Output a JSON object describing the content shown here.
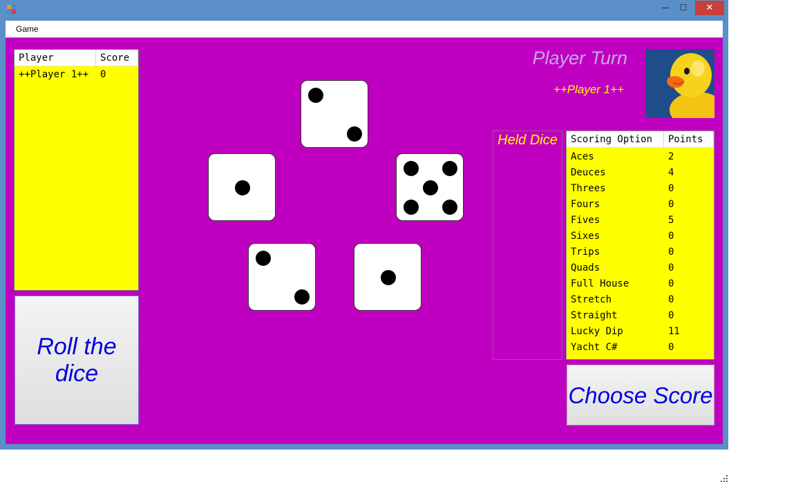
{
  "window": {
    "min_glyph": "—",
    "max_glyph": "☐",
    "close_glyph": "✕"
  },
  "menu": {
    "game": "Game"
  },
  "players_table": {
    "headers": {
      "player": "Player",
      "score": "Score"
    },
    "rows": [
      {
        "player": "++Player 1++",
        "score": "0"
      }
    ]
  },
  "roll_button": "Roll the dice",
  "turn": {
    "title": "Player Turn",
    "player": "++Player 1++"
  },
  "avatar_icon": "rubber-duck",
  "dice": [
    2,
    1,
    5,
    2,
    1
  ],
  "held_dice": {
    "title": "Held Dice",
    "values": []
  },
  "scoring_table": {
    "headers": {
      "option": "Scoring Option",
      "points": "Points"
    },
    "rows": [
      {
        "option": "Aces",
        "points": "2"
      },
      {
        "option": "Deuces",
        "points": "4"
      },
      {
        "option": "Threes",
        "points": "0"
      },
      {
        "option": "Fours",
        "points": "0"
      },
      {
        "option": "Fives",
        "points": "5"
      },
      {
        "option": "Sixes",
        "points": "0"
      },
      {
        "option": "Trips",
        "points": "0"
      },
      {
        "option": "Quads",
        "points": "0"
      },
      {
        "option": "Full House",
        "points": "0"
      },
      {
        "option": "Stretch",
        "points": "0"
      },
      {
        "option": "Straight",
        "points": "0"
      },
      {
        "option": "Lucky Dip",
        "points": "11"
      },
      {
        "option": "Yacht C#",
        "points": "0"
      }
    ]
  },
  "choose_button": "Choose Score",
  "colors": {
    "background": "#c000c0",
    "panel": "#ffff00",
    "button_text": "#0000e0",
    "turn_title": "#c8a6e6",
    "window_frame": "#5b8fc7",
    "close_button": "#c7403a"
  }
}
